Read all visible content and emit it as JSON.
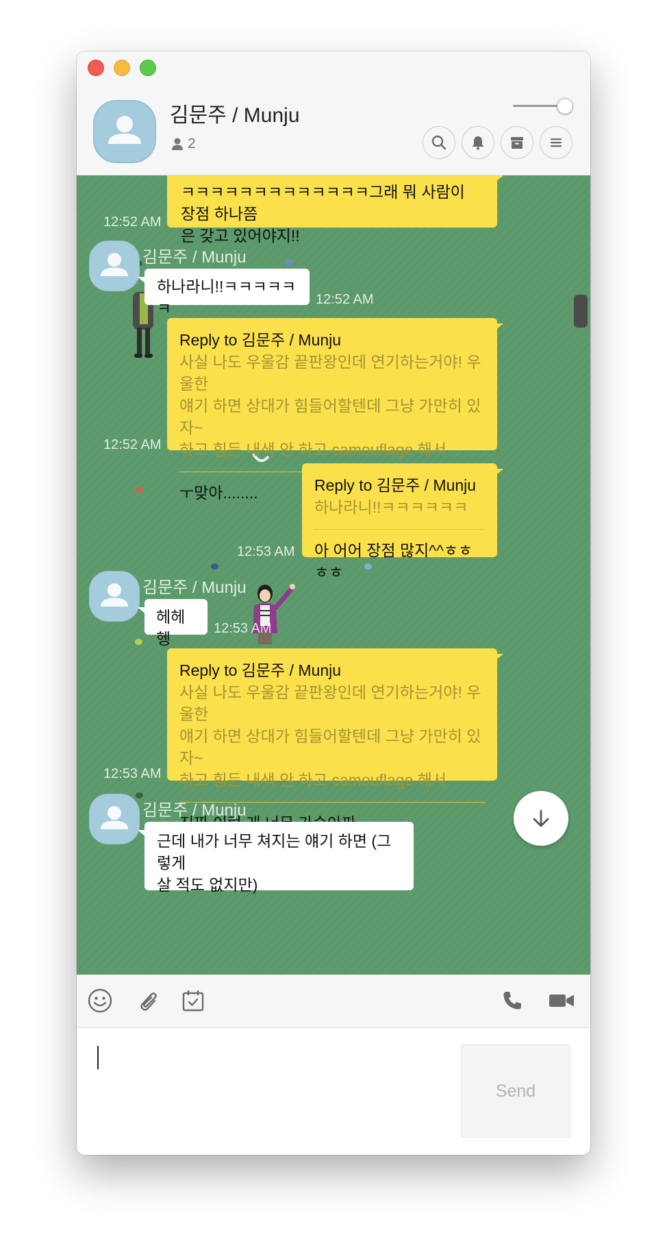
{
  "window": {
    "controls": [
      "close",
      "minimize",
      "zoom"
    ]
  },
  "header": {
    "title": "김문주 / Munju",
    "member_count": "2",
    "buttons": [
      "search-icon",
      "bell-icon",
      "archive-icon",
      "menu-icon"
    ]
  },
  "messages": {
    "m1": {
      "text": "ㅋㅋㅋㅋㅋㅋㅋㅋㅋㅋㅋㅋㅋ그래 뭐 사람이 장점 하나쯤 은 갖고 있어야지!!",
      "line1": "ㅋㅋㅋㅋㅋㅋㅋㅋㅋㅋㅋㅋㅋ그래 뭐 사람이 장점 하나쯤",
      "line2": "은 갖고 있어야지!!",
      "time": "12:52 AM"
    },
    "m2": {
      "sender": "김문주 / Munju",
      "text": "하나라니!!ㅋㅋㅋㅋㅋㅋ",
      "time": "12:52 AM"
    },
    "m3": {
      "reply_title": "Reply to 김문주 / Munju",
      "quote_l1": "사실 나도 우울감 끝판왕인데 연기하는거야! 우울한",
      "quote_l2": "얘기 하면 상대가 힘들어할텐데 그냥 가만히 있자~",
      "quote_l3": "하고 힘든 내색 안 하고 camouflage 해서",
      "text": "ㅜ맞아........",
      "time": "12:52 AM"
    },
    "m4": {
      "reply_title": "Reply to 김문주 / Munju",
      "quote": "하나라니!!ㅋㅋㅋㅋㅋㅋ",
      "text": "아 어어 장점 많지^^ㅎㅎㅎㅎ",
      "time": "12:53 AM"
    },
    "m5": {
      "sender": "김문주 / Munju",
      "text": "헤헤헹",
      "time": "12:53 AM"
    },
    "m6": {
      "reply_title": "Reply to 김문주 / Munju",
      "quote_l1": "사실 나도 우울감 끝판왕인데 연기하는거야! 우울한",
      "quote_l2": "얘기 하면 상대가 힘들어할텐데 그냥 가만히 있자~",
      "quote_l3": "하고 힘든 내색 안 하고 camouflage 해서",
      "text": "진짜 이런 게 너무 가슴아파",
      "time": "12:53 AM"
    },
    "m7": {
      "sender": "김문주 / Munju",
      "line1": "근데 내가 너무 쳐지는 얘기 하면 (그렇게",
      "line2": "살 적도 없지만)"
    }
  },
  "toolbar": {
    "left": [
      "emoji-icon",
      "attachment-icon",
      "calendar-icon"
    ],
    "right": [
      "phone-icon",
      "video-icon"
    ]
  },
  "composer": {
    "value": "",
    "send_label": "Send"
  },
  "colors": {
    "chat_background": "#5d9b6c",
    "my_bubble": "#fae04a",
    "their_bubble": "#ffffff",
    "avatar": "#a5ccdc"
  }
}
